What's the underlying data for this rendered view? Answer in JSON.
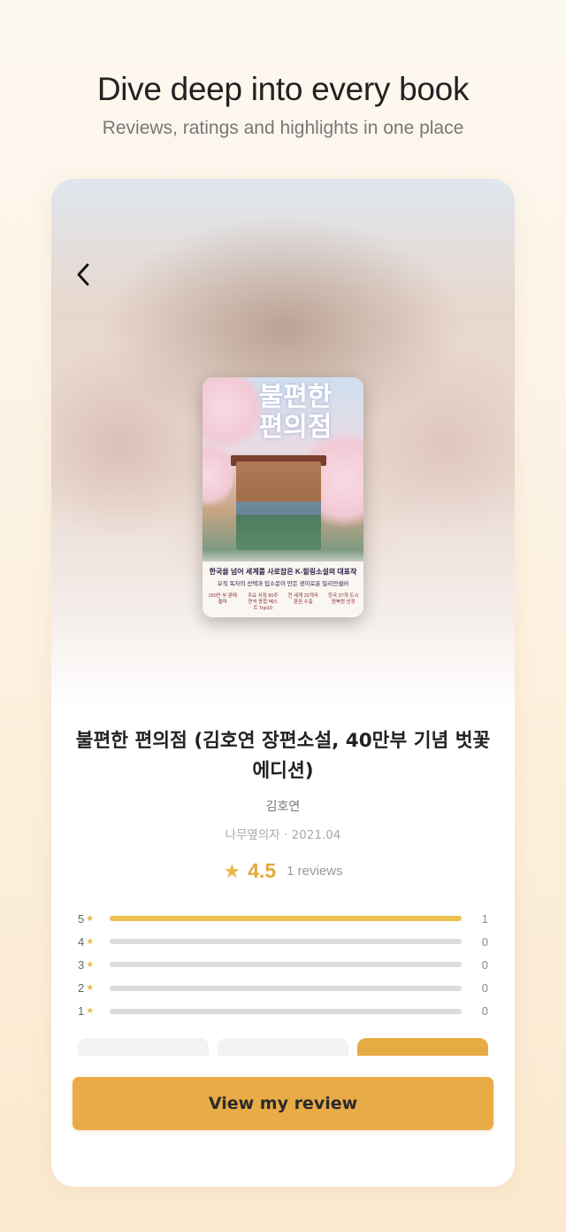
{
  "promo": {
    "headline": "Dive deep into every book",
    "subheadline": "Reviews, ratings and highlights in one place"
  },
  "book": {
    "title": "불편한 편의점 (김호연 장편소설, 40만부 기념 벗꽃 에디션)",
    "author": "김호연",
    "publisher_date": "나무옆의자 · 2021.04",
    "cover": {
      "title_art": "불편한 편의점",
      "tagline": "한국을 넘어 세계를 사로잡은 K-힐링소설의 대표작",
      "subline": "오직 독자의 선택과 입소문이 만든 경이로운 밀리언셀러",
      "chips": [
        "150만 부 판매 돌파",
        "주요 서점 80주 연속 종합 베스트 Top10",
        "전 세계 22개국 판권 수출",
        "한국 37개 도시 원북원 선정"
      ]
    }
  },
  "rating": {
    "star_icon": "★",
    "average": "4.5",
    "reviews_label": "1 reviews",
    "distribution": [
      {
        "stars": "5",
        "count": "1",
        "fraction": 1.0
      },
      {
        "stars": "4",
        "count": "0",
        "fraction": 0
      },
      {
        "stars": "3",
        "count": "0",
        "fraction": 0
      },
      {
        "stars": "2",
        "count": "0",
        "fraction": 0
      },
      {
        "stars": "1",
        "count": "0",
        "fraction": 0
      }
    ]
  },
  "actions": {
    "primary_label": "View my review"
  },
  "colors": {
    "accent": "#e9ab45",
    "star": "#e9b949",
    "bar_fill": "#ecc04e",
    "bar_track": "#dcdcdc"
  }
}
